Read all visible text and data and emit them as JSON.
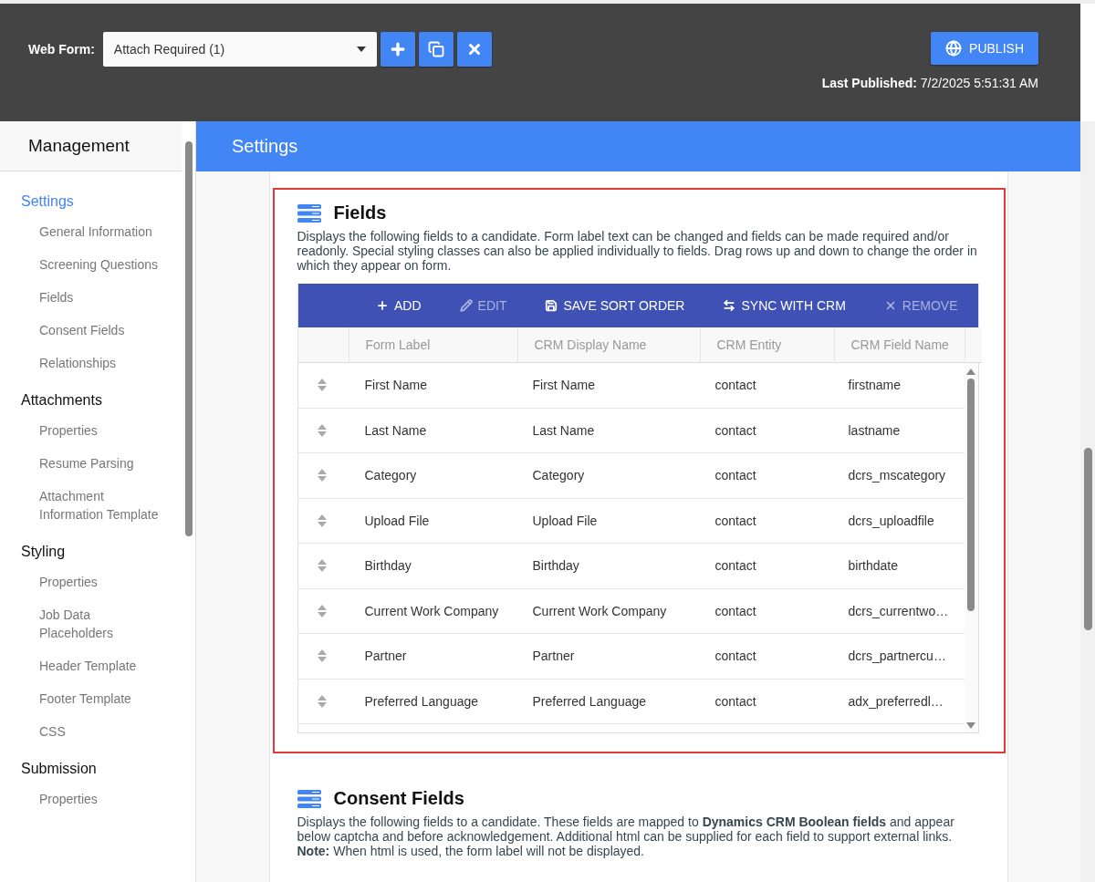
{
  "top_bar": {
    "web_form_label": "Web Form:",
    "web_form_value": "Attach Required (1)",
    "publish_button": "PUBLISH",
    "last_published_label": "Last Published:",
    "last_published_value": "7/2/2025 5:51:31 AM"
  },
  "sidebar": {
    "title": "Management",
    "sections": [
      {
        "label": "Settings",
        "selected": true,
        "items": [
          {
            "label": "General Information",
            "selected": false
          },
          {
            "label": "Screening Questions",
            "selected": false
          },
          {
            "label": "Fields",
            "selected": false
          },
          {
            "label": "Consent Fields",
            "selected": false
          },
          {
            "label": "Relationships",
            "selected": false
          }
        ]
      },
      {
        "label": "Attachments",
        "selected": false,
        "items": [
          {
            "label": "Properties",
            "selected": false
          },
          {
            "label": "Resume Parsing",
            "selected": false
          },
          {
            "label": "Attachment Information Template",
            "selected": false
          }
        ]
      },
      {
        "label": "Styling",
        "selected": false,
        "items": [
          {
            "label": "Properties",
            "selected": false
          },
          {
            "label": "Job Data Placeholders",
            "selected": false
          },
          {
            "label": "Header Template",
            "selected": false
          },
          {
            "label": "Footer Template",
            "selected": false
          },
          {
            "label": "CSS",
            "selected": false
          }
        ]
      },
      {
        "label": "Submission",
        "selected": false,
        "items": [
          {
            "label": "Properties",
            "selected": false
          }
        ]
      }
    ]
  },
  "page_header": "Settings",
  "fields_panel": {
    "title": "Fields",
    "description": "Displays the following fields to a candidate. Form label text can be changed and fields can be made required and/or readonly. Special styling classes can also be applied individually to fields. Drag rows up and down to change the order in which they appear on form.",
    "toolbar": [
      {
        "kind": "add",
        "label": "ADD",
        "disabled": false
      },
      {
        "kind": "edit",
        "label": "EDIT",
        "disabled": true
      },
      {
        "kind": "save",
        "label": "SAVE SORT ORDER",
        "disabled": false
      },
      {
        "kind": "sync",
        "label": "SYNC WITH CRM",
        "disabled": false
      },
      {
        "kind": "remove",
        "label": "REMOVE",
        "disabled": true
      }
    ],
    "table": {
      "columns": [
        "Form Label",
        "CRM Display Name",
        "CRM Entity",
        "CRM Field Name"
      ],
      "rows": [
        [
          "First Name",
          "First Name",
          "contact",
          "firstname"
        ],
        [
          "Last Name",
          "Last Name",
          "contact",
          "lastname"
        ],
        [
          "Category",
          "Category",
          "contact",
          "dcrs_mscategory"
        ],
        [
          "Upload File",
          "Upload File",
          "contact",
          "dcrs_uploadfile"
        ],
        [
          "Birthday",
          "Birthday",
          "contact",
          "birthdate"
        ],
        [
          "Current Work Company",
          "Current Work Company",
          "contact",
          "dcrs_currentwo…"
        ],
        [
          "Partner",
          "Partner",
          "contact",
          "dcrs_partnercu…"
        ],
        [
          "Preferred Language",
          "Preferred Language",
          "contact",
          "adx_preferredl…"
        ]
      ]
    }
  },
  "consent_panel": {
    "title": "Consent Fields",
    "description": "Displays the following fields to a candidate. These fields are mapped to **Dynamics CRM Boolean fields** and appear below captcha and before acknowledgement. Additional html can be supplied for each field to support external links.",
    "note": "**Note:** When html is used, the form label will not be displayed."
  }
}
